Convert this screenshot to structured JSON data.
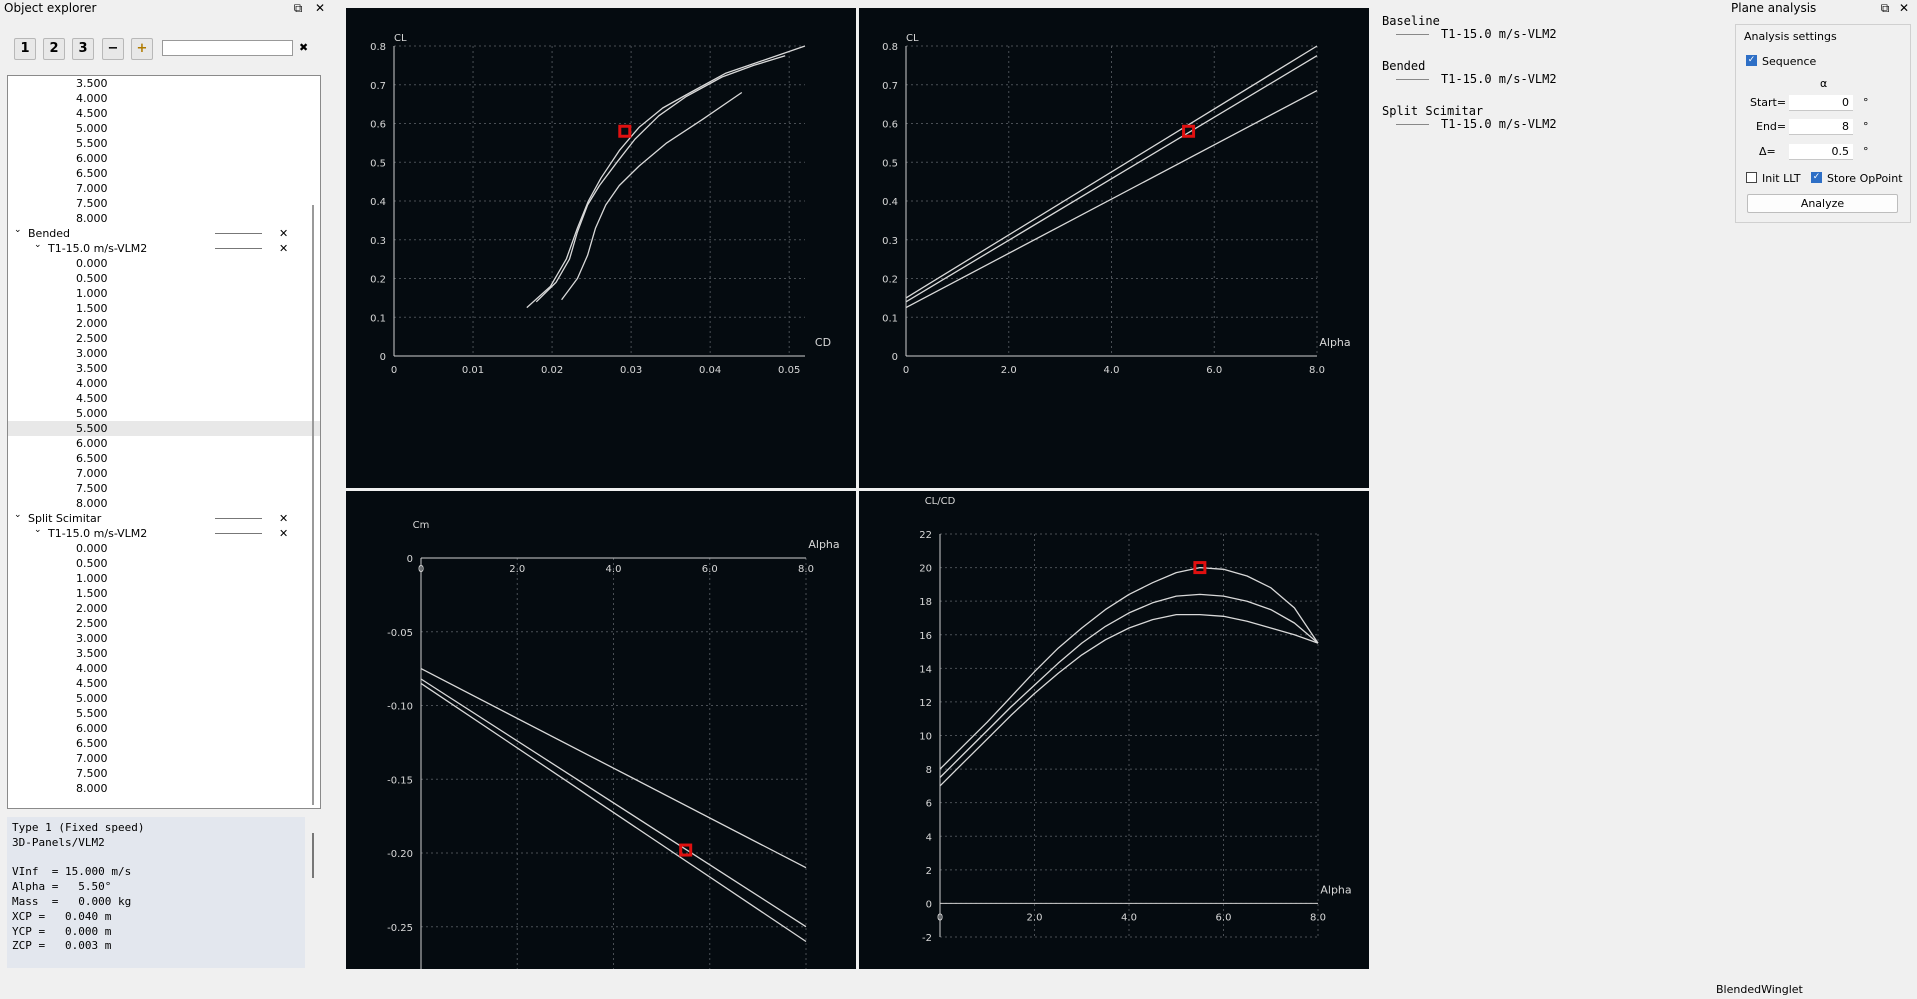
{
  "explorer": {
    "title": "Object explorer",
    "toolbar": {
      "btn1": "1",
      "btn2": "2",
      "btn3": "3",
      "minus": "−",
      "plus": "+",
      "search_value": "",
      "clear": "✖"
    },
    "tree": [
      {
        "text": "3.500",
        "level": 3
      },
      {
        "text": "4.000",
        "level": 3
      },
      {
        "text": "4.500",
        "level": 3
      },
      {
        "text": "5.000",
        "level": 3
      },
      {
        "text": "5.500",
        "level": 3
      },
      {
        "text": "6.000",
        "level": 3
      },
      {
        "text": "6.500",
        "level": 3
      },
      {
        "text": "7.000",
        "level": 3
      },
      {
        "text": "7.500",
        "level": 3
      },
      {
        "text": "8.000",
        "level": 3
      },
      {
        "text": "Bended",
        "level": 1,
        "expand": true,
        "style": true,
        "delete": true
      },
      {
        "text": "T1-15.0 m/s-VLM2",
        "level": 2,
        "expand": true,
        "style": true,
        "delete": true
      },
      {
        "text": "0.000",
        "level": 3
      },
      {
        "text": "0.500",
        "level": 3
      },
      {
        "text": "1.000",
        "level": 3
      },
      {
        "text": "1.500",
        "level": 3
      },
      {
        "text": "2.000",
        "level": 3
      },
      {
        "text": "2.500",
        "level": 3
      },
      {
        "text": "3.000",
        "level": 3
      },
      {
        "text": "3.500",
        "level": 3
      },
      {
        "text": "4.000",
        "level": 3
      },
      {
        "text": "4.500",
        "level": 3
      },
      {
        "text": "5.000",
        "level": 3
      },
      {
        "text": "5.500",
        "level": 3,
        "highlight": true
      },
      {
        "text": "6.000",
        "level": 3
      },
      {
        "text": "6.500",
        "level": 3
      },
      {
        "text": "7.000",
        "level": 3
      },
      {
        "text": "7.500",
        "level": 3
      },
      {
        "text": "8.000",
        "level": 3
      },
      {
        "text": "Split Scimitar",
        "level": 1,
        "expand": true,
        "style": true,
        "delete": true
      },
      {
        "text": "T1-15.0 m/s-VLM2",
        "level": 2,
        "expand": true,
        "style": true,
        "delete": true
      },
      {
        "text": "0.000",
        "level": 3
      },
      {
        "text": "0.500",
        "level": 3
      },
      {
        "text": "1.000",
        "level": 3
      },
      {
        "text": "1.500",
        "level": 3
      },
      {
        "text": "2.000",
        "level": 3
      },
      {
        "text": "2.500",
        "level": 3
      },
      {
        "text": "3.000",
        "level": 3
      },
      {
        "text": "3.500",
        "level": 3
      },
      {
        "text": "4.000",
        "level": 3
      },
      {
        "text": "4.500",
        "level": 3
      },
      {
        "text": "5.000",
        "level": 3
      },
      {
        "text": "5.500",
        "level": 3
      },
      {
        "text": "6.000",
        "level": 3
      },
      {
        "text": "6.500",
        "level": 3
      },
      {
        "text": "7.000",
        "level": 3
      },
      {
        "text": "7.500",
        "level": 3
      },
      {
        "text": "8.000",
        "level": 3
      }
    ],
    "info": "Type 1 (Fixed speed)\n3D-Panels/VLM2\n\nVInf  = 15.000 m/s\nAlpha =   5.50°\nMass  =   0.000 kg\nXCP =   0.040 m\nYCP =   0.000 m\nZCP =   0.003 m"
  },
  "legend": [
    {
      "name": "Baseline",
      "polar": "T1-15.0 m/s-VLM2"
    },
    {
      "name": "Bended",
      "polar": "T1-15.0 m/s-VLM2"
    },
    {
      "name": "Split Scimitar",
      "polar": "T1-15.0 m/s-VLM2"
    }
  ],
  "analysis": {
    "title": "Plane analysis",
    "group": "Analysis settings",
    "sequence_label": "Sequence",
    "sequence_checked": true,
    "var_symbol": "α",
    "start_label": "Start=",
    "start_value": "0",
    "end_label": "End=",
    "end_value": "8",
    "delta_label": "Δ=",
    "delta_value": "0.5",
    "unit": "°",
    "init_llt_label": "Init LLT",
    "init_llt_checked": false,
    "store_label": "Store OpPoint",
    "store_checked": true,
    "analyze_label": "Analyze"
  },
  "status": {
    "plane_name": "BlendedWinglet"
  },
  "colors": {
    "graph_bg": "#050b10",
    "curve": "#d9d9d9",
    "grid": "#4a4f55",
    "marker": "#e01010",
    "selection": "#2e6fc6"
  },
  "chart_data": [
    {
      "type": "line",
      "xlabel": "CD",
      "ylabel": "CL",
      "xlim": [
        0,
        0.052
      ],
      "ylim": [
        0,
        0.8
      ],
      "xticks": [
        "0",
        "0.01",
        "0.02",
        "0.03",
        "0.04",
        "0.05"
      ],
      "yticks": [
        "0",
        "0.1",
        "0.2",
        "0.3",
        "0.4",
        "0.5",
        "0.6",
        "0.7",
        "0.8"
      ],
      "series": [
        {
          "x": [
            0.0168,
            0.0198,
            0.0218,
            0.0232,
            0.0246,
            0.0262,
            0.0285,
            0.031,
            0.034,
            0.0375,
            0.042,
            0.047,
            0.052
          ],
          "y": [
            0.125,
            0.18,
            0.25,
            0.33,
            0.4,
            0.46,
            0.53,
            0.59,
            0.64,
            0.68,
            0.73,
            0.765,
            0.8
          ]
        },
        {
          "x": [
            0.018,
            0.0205,
            0.0222,
            0.0232,
            0.0245,
            0.026,
            0.0282,
            0.0305,
            0.0335,
            0.037,
            0.0415,
            0.0455,
            0.0495
          ],
          "y": [
            0.14,
            0.19,
            0.25,
            0.32,
            0.39,
            0.44,
            0.5,
            0.56,
            0.62,
            0.67,
            0.72,
            0.75,
            0.775
          ]
        },
        {
          "x": [
            0.0212,
            0.0232,
            0.0245,
            0.0255,
            0.0268,
            0.0285,
            0.031,
            0.0345,
            0.039,
            0.044
          ],
          "y": [
            0.145,
            0.2,
            0.26,
            0.33,
            0.39,
            0.44,
            0.49,
            0.55,
            0.61,
            0.68
          ]
        }
      ],
      "marker": {
        "x": 0.0292,
        "y": 0.58
      }
    },
    {
      "type": "line",
      "xlabel": "Alpha",
      "ylabel": "CL",
      "xlim": [
        0,
        8.0
      ],
      "ylim": [
        0,
        0.8
      ],
      "xticks": [
        "0",
        "2.0",
        "4.0",
        "6.0",
        "8.0"
      ],
      "yticks": [
        "0",
        "0.1",
        "0.2",
        "0.3",
        "0.4",
        "0.5",
        "0.6",
        "0.7",
        "0.8"
      ],
      "series": [
        {
          "x": [
            0,
            8
          ],
          "y": [
            0.15,
            0.8
          ]
        },
        {
          "x": [
            0,
            8
          ],
          "y": [
            0.14,
            0.775
          ]
        },
        {
          "x": [
            0,
            8
          ],
          "y": [
            0.125,
            0.685
          ]
        }
      ],
      "marker": {
        "x": 5.5,
        "y": 0.58
      }
    },
    {
      "type": "line",
      "xlabel": "Alpha",
      "ylabel": "Cm",
      "xlim": [
        0,
        8.0
      ],
      "ylim": [
        -0.28,
        0
      ],
      "xticks": [
        "0",
        "2.0",
        "4.0",
        "6.0",
        "8.0"
      ],
      "yticks": [
        "0",
        "-0.05",
        "-0.10",
        "-0.15",
        "-0.20",
        "-0.25"
      ],
      "series": [
        {
          "x": [
            0,
            8
          ],
          "y": [
            -0.075,
            -0.21
          ]
        },
        {
          "x": [
            0,
            8
          ],
          "y": [
            -0.082,
            -0.25
          ]
        },
        {
          "x": [
            0,
            8
          ],
          "y": [
            -0.085,
            -0.26
          ]
        }
      ],
      "marker": {
        "x": 5.5,
        "y": -0.198
      }
    },
    {
      "type": "line",
      "xlabel": "Alpha",
      "ylabel": "CL/CD",
      "xlim": [
        0,
        8.0
      ],
      "ylim": [
        -2,
        22
      ],
      "xticks": [
        "0",
        "2.0",
        "4.0",
        "6.0",
        "8.0"
      ],
      "yticks": [
        "-2",
        "0",
        "2",
        "4",
        "6",
        "8",
        "10",
        "12",
        "14",
        "16",
        "18",
        "20",
        "22"
      ],
      "series": [
        {
          "x": [
            0,
            0.5,
            1,
            1.5,
            2,
            2.5,
            3,
            3.5,
            4,
            4.5,
            5,
            5.5,
            6,
            6.5,
            7,
            7.5,
            8
          ],
          "y": [
            8.0,
            9.4,
            10.8,
            12.3,
            13.8,
            15.2,
            16.4,
            17.5,
            18.4,
            19.1,
            19.7,
            20.0,
            19.9,
            19.5,
            18.8,
            17.6,
            15.5
          ]
        },
        {
          "x": [
            0,
            0.5,
            1,
            1.5,
            2,
            2.5,
            3,
            3.5,
            4,
            4.5,
            5,
            5.5,
            6,
            6.5,
            7,
            7.5,
            8
          ],
          "y": [
            7.5,
            8.9,
            10.3,
            11.7,
            13.0,
            14.3,
            15.5,
            16.5,
            17.3,
            17.9,
            18.3,
            18.4,
            18.3,
            18.0,
            17.5,
            16.7,
            15.5
          ]
        },
        {
          "x": [
            0,
            0.5,
            1,
            1.5,
            2,
            2.5,
            3,
            3.5,
            4,
            4.5,
            5,
            5.5,
            6,
            6.5,
            7,
            7.5,
            8
          ],
          "y": [
            7.0,
            8.4,
            9.8,
            11.2,
            12.5,
            13.7,
            14.8,
            15.7,
            16.4,
            16.9,
            17.2,
            17.2,
            17.1,
            16.8,
            16.4,
            16.0,
            15.5
          ]
        }
      ],
      "marker": {
        "x": 5.5,
        "y": 20.0
      }
    }
  ]
}
